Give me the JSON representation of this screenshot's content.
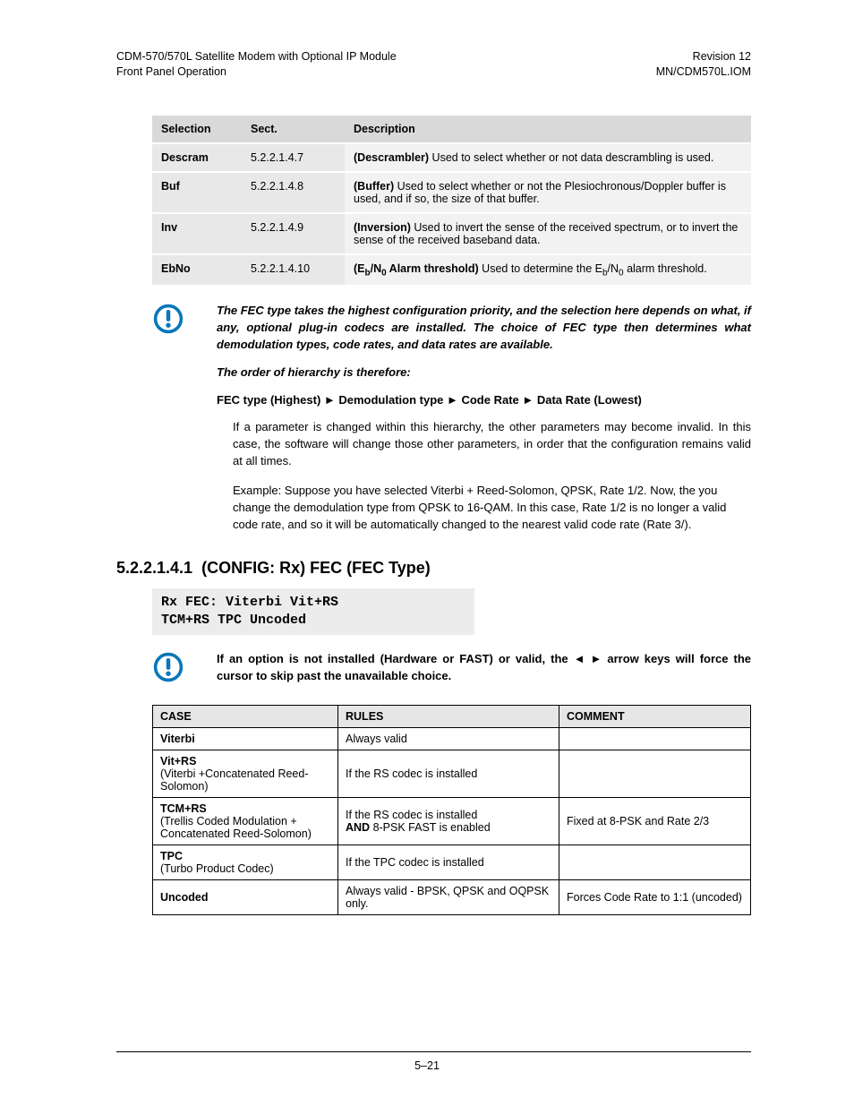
{
  "header": {
    "left_line1": "CDM-570/570L Satellite Modem with Optional IP Module",
    "left_line2": "Front Panel Operation",
    "right_line1": "Revision 12",
    "right_line2": "MN/CDM570L.IOM"
  },
  "table1": {
    "headers": {
      "selection": "Selection",
      "sect": "Sect.",
      "description": "Description"
    },
    "rows": [
      {
        "sel": "Descram",
        "sect": "5.2.2.1.4.7",
        "desc_bold": "(Descrambler)",
        "desc_rest": " Used to select whether or not data descrambling is used."
      },
      {
        "sel": "Buf",
        "sect": "5.2.2.1.4.8",
        "desc_bold": "(Buffer)",
        "desc_rest": " Used to select whether or not the Plesiochronous/Doppler buffer is used, and if so, the size of that buffer."
      },
      {
        "sel": "Inv",
        "sect": "5.2.2.1.4.9",
        "desc_bold": "(Inversion)",
        "desc_rest": " Used to invert the sense of the received spectrum, or to invert the sense of the received baseband data."
      },
      {
        "sel": "EbNo",
        "sect": "5.2.2.1.4.10",
        "desc_bold_html": "(E<sub>b</sub>/N<sub>0</sub> Alarm threshold)",
        "desc_rest_html": " Used to determine the E<sub>b</sub>/N<sub>0</sub> alarm threshold."
      }
    ]
  },
  "note1": {
    "p1": "The FEC type takes the highest configuration priority, and the selection here depends on what, if any, optional plug-in codecs are installed. The choice of FEC type then determines what demodulation types, code rates, and data rates are available.",
    "p2": "The order of hierarchy is therefore:",
    "p3": "FEC type (Highest)  ►  Demodulation type  ►  Code Rate  ►  Data Rate (Lowest)"
  },
  "body": {
    "p1": "If a parameter is changed within this hierarchy, the other parameters may become invalid. In this case, the software will change those other parameters, in order that the configuration remains valid at all times.",
    "p2": "Example: Suppose you have selected Viterbi + Reed-Solomon, QPSK, Rate 1/2. Now, the you change the demodulation type from QPSK to 16-QAM. In this case, Rate 1/2 is no longer a valid code rate, and so it will be automatically changed to the nearest valid code rate (Rate 3/)."
  },
  "section": {
    "number": "5.2.2.1.4.1",
    "title": "(CONFIG: Rx) FEC (FEC Type)"
  },
  "code": {
    "line1": "Rx FEC: Viterbi Vit+RS",
    "line2": "TCM+RS TPC Uncoded"
  },
  "note2": {
    "text": "If an option is not installed (Hardware or FAST) or valid, the ◄ ► arrow keys will force the cursor to skip past the unavailable choice."
  },
  "table2": {
    "headers": {
      "case": "CASE",
      "rules": "RULES",
      "comment": "COMMENT"
    },
    "rows": [
      {
        "case_main": "Viterbi",
        "case_sub": "",
        "rules": "Always valid",
        "comment": ""
      },
      {
        "case_main": "Vit+RS",
        "case_sub": "(Viterbi +Concatenated Reed-Solomon)",
        "rules": "If the RS codec is installed",
        "comment": ""
      },
      {
        "case_main": "TCM+RS",
        "case_sub": "(Trellis Coded Modulation + Concatenated Reed-Solomon)",
        "rules_html": "If the RS codec is installed<br><b>AND</b> 8-PSK FAST is enabled",
        "comment": "Fixed at 8-PSK and Rate 2/3"
      },
      {
        "case_main": "TPC",
        "case_sub": "(Turbo Product Codec)",
        "rules": "If the TPC codec is installed",
        "comment": ""
      },
      {
        "case_main": "Uncoded",
        "case_sub": "",
        "rules": "Always valid - BPSK, QPSK and OQPSK only.",
        "comment": "Forces Code Rate to 1:1 (uncoded)"
      }
    ]
  },
  "footer": {
    "page": "5–21"
  }
}
